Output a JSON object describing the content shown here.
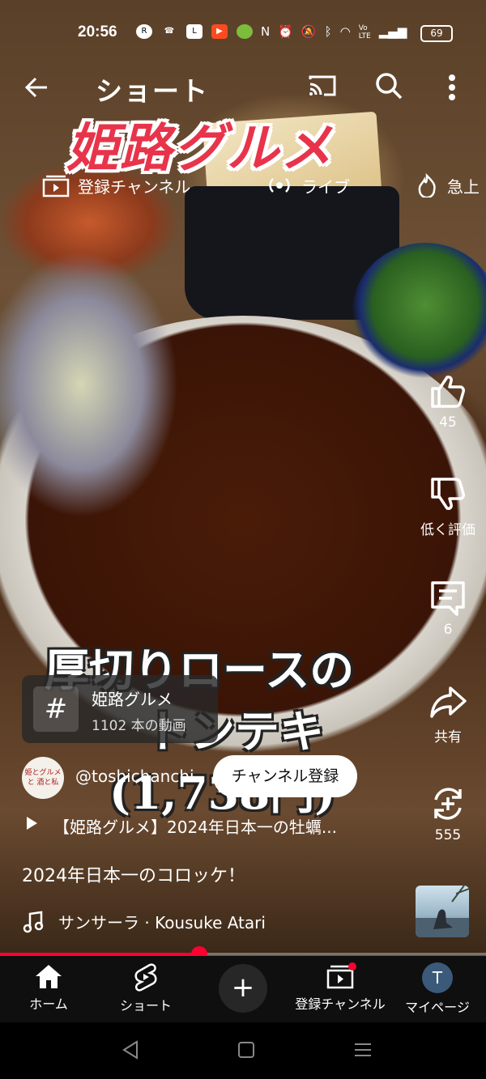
{
  "status_bar": {
    "time": "20:56",
    "battery": "69",
    "icons": [
      "r-link-icon",
      "missed-call-icon",
      "line-icon",
      "video-icon",
      "frog-icon"
    ]
  },
  "top_bar": {
    "title": "ショート"
  },
  "overlay": {
    "title": "姫路グルメ",
    "caption_line1": "厚切りロースの",
    "caption_line2": "トンテキ",
    "caption_line3": "(1,738円)"
  },
  "chips": [
    {
      "label": "登録チャンネル",
      "icon": "subscriptions-icon"
    },
    {
      "label": "ライブ",
      "icon": "live-icon"
    },
    {
      "label": "急上",
      "icon": "trending-icon"
    }
  ],
  "actions": {
    "like_count": "45",
    "dislike_label": "低く評価",
    "comment_count": "6",
    "share_label": "共有",
    "remix_count": "555"
  },
  "hashtag": {
    "symbol": "#",
    "name": "姫路グルメ",
    "video_count": "1102 本の動画"
  },
  "channel": {
    "handle": "@toshichanchi",
    "avatar_text": "姫とグルメと 酒と私",
    "subscribe_label": "チャンネル登録"
  },
  "related_video": "【姫路グルメ】2024年日本一の牡蠣...",
  "description": "2024年日本一のコロッケ！",
  "music": "サンサーラ · Kousuke Atari",
  "progress": 0.41,
  "bottom_nav": [
    {
      "label": "ホーム",
      "icon": "home-icon"
    },
    {
      "label": "ショート",
      "icon": "shorts-icon"
    },
    {
      "label": "",
      "icon": "create-icon"
    },
    {
      "label": "登録チャンネル",
      "icon": "subscriptions-icon"
    },
    {
      "label": "マイページ",
      "icon": "avatar",
      "avatar_letter": "T"
    }
  ],
  "colors": {
    "accent": "#ff0033",
    "title_pink": "#e8344a",
    "nav_bg": "#0f0f0f"
  }
}
